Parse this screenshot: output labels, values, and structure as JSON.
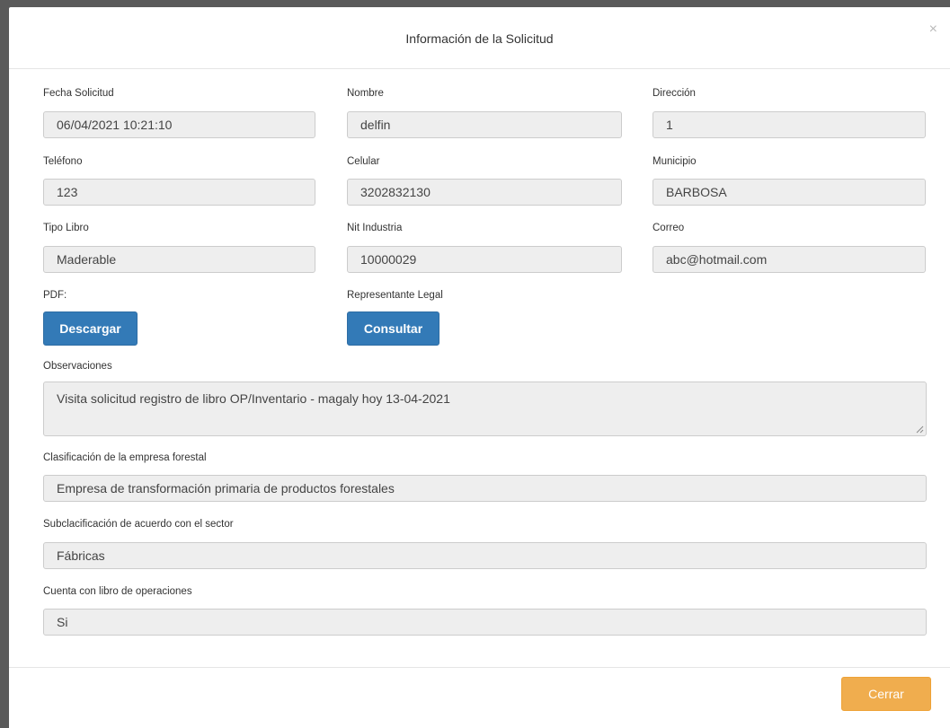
{
  "modal": {
    "title": "Información de la Solicitud",
    "close_glyph": "×"
  },
  "fields": {
    "fecha_solicitud": {
      "label": "Fecha Solicitud",
      "value": "06/04/2021 10:21:10"
    },
    "nombre": {
      "label": "Nombre",
      "value": "delfin"
    },
    "direccion": {
      "label": "Dirección",
      "value": "1"
    },
    "telefono": {
      "label": "Teléfono",
      "value": "123"
    },
    "celular": {
      "label": "Celular",
      "value": "3202832130"
    },
    "municipio": {
      "label": "Municipio",
      "value": "BARBOSA"
    },
    "tipo_libro": {
      "label": "Tipo Libro",
      "value": "Maderable"
    },
    "nit_industria": {
      "label": "Nit Industria",
      "value": "10000029"
    },
    "correo": {
      "label": "Correo",
      "value": "abc@hotmail.com"
    }
  },
  "pdf": {
    "label": "PDF:",
    "button": "Descargar"
  },
  "representante": {
    "label": "Representante Legal",
    "button": "Consultar"
  },
  "observaciones": {
    "label": "Observaciones",
    "value": "Visita solicitud registro de libro OP/Inventario - magaly hoy 13-04-2021"
  },
  "clasificacion": {
    "label": "Clasificación de la empresa forestal",
    "value": "Empresa de transformación primaria de productos forestales"
  },
  "subclasificacion": {
    "label": "Subclacificación de acuerdo con el sector",
    "value": "Fábricas"
  },
  "libro_operaciones": {
    "label": "Cuenta con libro de operaciones",
    "value": "Si"
  },
  "footer": {
    "close_button": "Cerrar"
  },
  "colors": {
    "primary": "#337ab7",
    "warning": "#f0ad4e",
    "field_bg": "#eeeeee"
  }
}
